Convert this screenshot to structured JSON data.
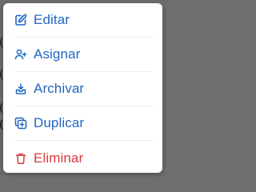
{
  "menu": {
    "items": [
      {
        "label": "Editar",
        "icon": "edit-icon",
        "color": "#1f67c2"
      },
      {
        "label": "Asignar",
        "icon": "user-plus-icon",
        "color": "#1f67c2"
      },
      {
        "label": "Archivar",
        "icon": "archive-icon",
        "color": "#1f67c2"
      },
      {
        "label": "Duplicar",
        "icon": "copy-icon",
        "color": "#1f67c2"
      },
      {
        "label": "Eliminar",
        "icon": "trash-icon",
        "color": "#d93a3a"
      }
    ]
  }
}
